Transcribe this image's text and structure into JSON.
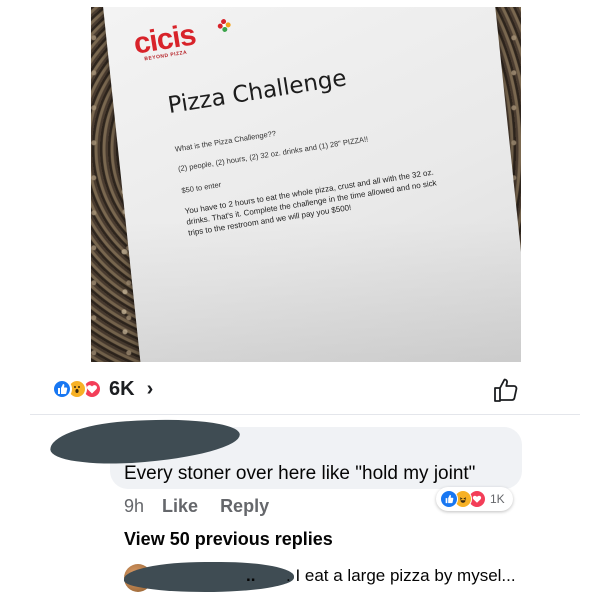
{
  "photo": {
    "logo": "cicis",
    "logo_tagline": "BEYOND PIZZA",
    "title": "Pizza Challenge",
    "question": "What is the Pizza Challenge??",
    "requirements": "(2) people, (2) hours, (2) 32 oz. drinks and (1) 28\" PIZZA!!",
    "entry_fee": "$50 to enter",
    "rules": "You have to 2 hours to eat the whole pizza, crust and all with the 32 oz. drinks. That's it. Complete the challenge in the time allowed and no sick trips to the restroom and we will pay you $500!"
  },
  "post": {
    "reaction_icons": [
      "like-icon",
      "wow-icon",
      "love-icon"
    ],
    "reaction_count": "6K",
    "chevron": "›",
    "like_icon": "thumbs-up-outline-icon"
  },
  "comment": {
    "text": "Every stoner over here like \"hold my joint\"",
    "time": "9h",
    "like_label": "Like",
    "reply_label": "Reply",
    "reaction_icons": [
      "like-icon",
      "haha-icon",
      "love-icon"
    ],
    "reaction_count": "1K"
  },
  "replies": {
    "view_previous": "View 50 previous replies",
    "preview_name_fragment": "..",
    "preview_text": ". I eat a large pizza by mysel..."
  },
  "colors": {
    "like_blue": "#1877f2",
    "love_red": "#f33e58",
    "wow_yellow": "#f7b125",
    "bubble_gray": "#f0f2f5",
    "secondary_text": "#65676b",
    "logo_red": "#d8232a",
    "redaction": "#3f4c53"
  }
}
